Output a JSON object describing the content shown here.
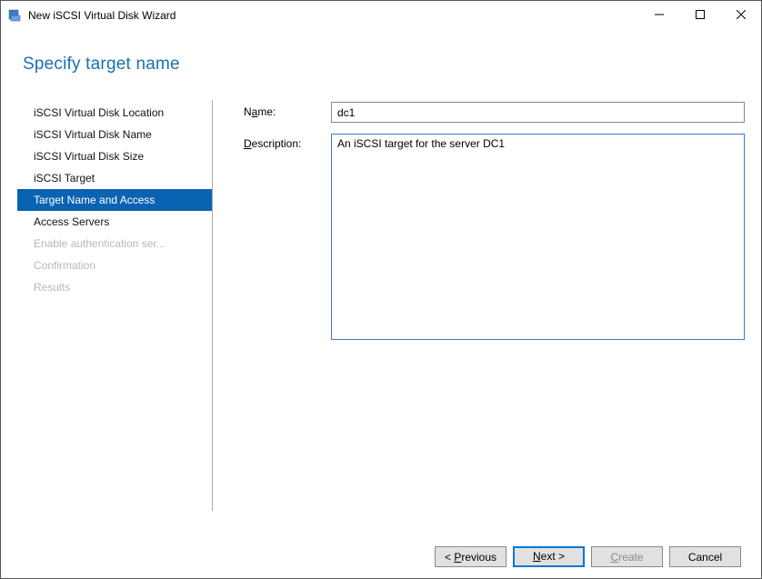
{
  "window": {
    "title": "New iSCSI Virtual Disk Wizard"
  },
  "header": {
    "page_title": "Specify target name"
  },
  "sidebar": {
    "items": [
      {
        "label": "iSCSI Virtual Disk Location",
        "state": "normal"
      },
      {
        "label": "iSCSI Virtual Disk Name",
        "state": "normal"
      },
      {
        "label": "iSCSI Virtual Disk Size",
        "state": "normal"
      },
      {
        "label": "iSCSI Target",
        "state": "normal"
      },
      {
        "label": "Target Name and Access",
        "state": "selected"
      },
      {
        "label": "Access Servers",
        "state": "normal"
      },
      {
        "label": "Enable authentication ser...",
        "state": "disabled"
      },
      {
        "label": "Confirmation",
        "state": "disabled"
      },
      {
        "label": "Results",
        "state": "disabled"
      }
    ]
  },
  "form": {
    "name_label_pre": "N",
    "name_label_u": "a",
    "name_label_post": "me:",
    "name_value": "dc1",
    "desc_label_pre": "",
    "desc_label_u": "D",
    "desc_label_post": "escription:",
    "desc_value": "An iSCSI target for the server DC1"
  },
  "buttons": {
    "previous_pre": "< ",
    "previous_u": "P",
    "previous_post": "revious",
    "next_pre": "",
    "next_u": "N",
    "next_post": "ext >",
    "create_pre": "",
    "create_u": "C",
    "create_post": "reate",
    "cancel": "Cancel"
  }
}
